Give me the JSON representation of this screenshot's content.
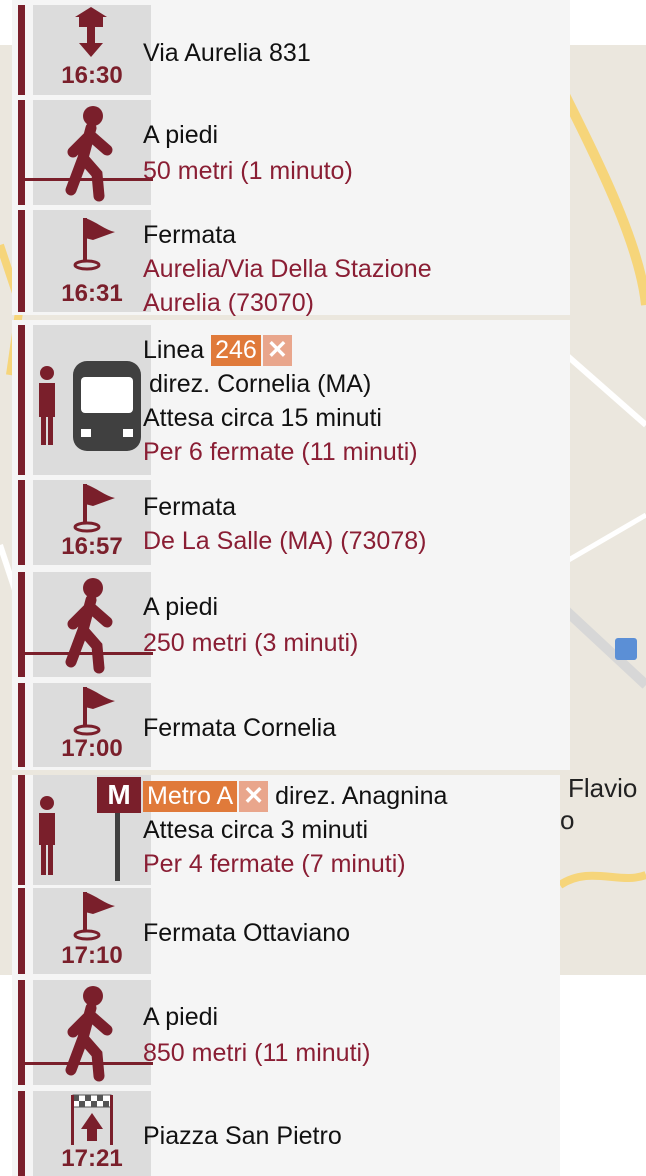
{
  "map": {
    "labels": [
      "Flavio",
      "o"
    ]
  },
  "steps": [
    {
      "type": "start",
      "time": "16:30",
      "lines": [
        "Via Aurelia 831"
      ]
    },
    {
      "type": "walk",
      "title": "A piedi",
      "detail": "50 metri (1 minuto)"
    },
    {
      "type": "stop",
      "time": "16:31",
      "title": "Fermata",
      "detail_lines": [
        "Aurelia/Via Della Stazione",
        "Aurelia (73070)"
      ]
    },
    {
      "type": "bus",
      "line_label": "Linea",
      "line_number": "246",
      "remove_symbol": "✕",
      "direction": "direz. Cornelia (MA)",
      "wait": "Attesa circa 15 minuti",
      "detail": "Per 6 fermate (11 minuti)"
    },
    {
      "type": "stop",
      "time": "16:57",
      "title": "Fermata",
      "detail_lines": [
        "De La Salle (MA) (73078)"
      ]
    },
    {
      "type": "walk",
      "title": "A piedi",
      "detail": "250 metri (3 minuti)"
    },
    {
      "type": "stop",
      "time": "17:00",
      "title": "Fermata Cornelia"
    },
    {
      "type": "metro",
      "line_number": "Metro A",
      "remove_symbol": "✕",
      "direction": "direz. Anagnina",
      "wait": "Attesa circa 3 minuti",
      "detail": "Per 4 fermate (7 minuti)",
      "metro_letter": "M"
    },
    {
      "type": "stop",
      "time": "17:10",
      "title": "Fermata Ottaviano"
    },
    {
      "type": "walk",
      "title": "A piedi",
      "detail": "850 metri (11 minuti)"
    },
    {
      "type": "finish",
      "time": "17:21",
      "title": "Piazza San Pietro"
    }
  ],
  "colors": {
    "accent": "#7a1f2b",
    "link": "#8a1e34",
    "badge": "#e07a3a",
    "icon_bg": "#dcdcdc",
    "panel_bg": "#f5f5f5"
  }
}
